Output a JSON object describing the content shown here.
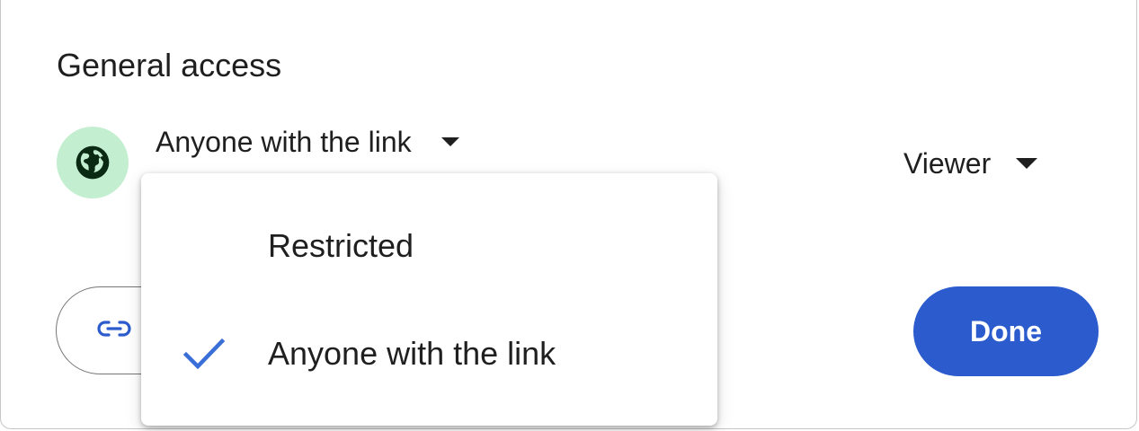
{
  "general_access": {
    "title": "General access",
    "access_level": {
      "selected": "Anyone with the link",
      "icon": "globe-icon",
      "icon_bg_color": "#c4eed0",
      "dropdown_icon": "caret-down-icon"
    },
    "role": {
      "selected": "Viewer",
      "dropdown_icon": "caret-down-icon"
    }
  },
  "footer": {
    "copy_link_icon": "link-icon",
    "done_label": "Done",
    "done_color": "#2b5bcd"
  },
  "access_menu": {
    "items": [
      {
        "label": "Restricted",
        "checked": false
      },
      {
        "label": "Anyone with the link",
        "checked": true
      }
    ],
    "check_icon": "checkmark-icon",
    "check_color": "#3b6fd8"
  }
}
